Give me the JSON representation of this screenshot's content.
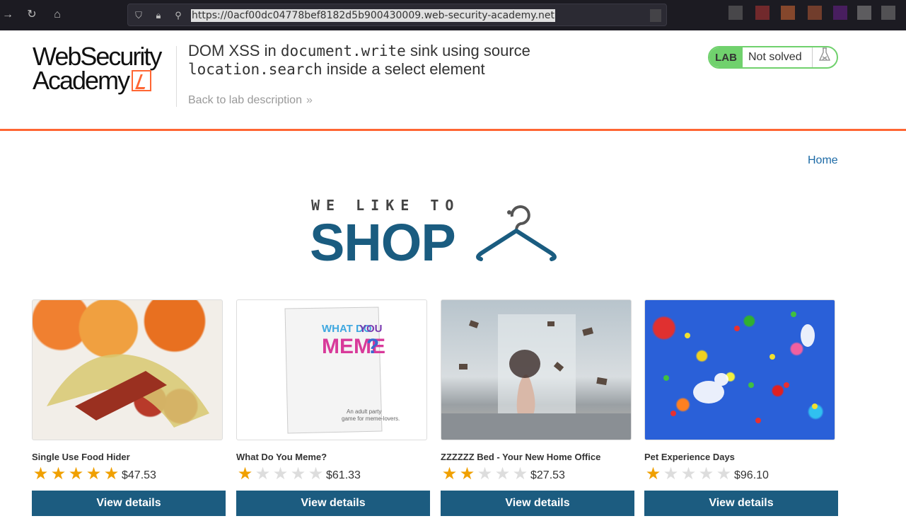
{
  "browser": {
    "url": "https://0acf00dc04778bef8182d5b900430009.web-security-academy.net",
    "back_icon": "arrow-right-icon",
    "reload_icon": "reload-icon",
    "home_icon": "home-icon"
  },
  "lab": {
    "logo_line1": "WebSecurity",
    "logo_line2": "Academy",
    "title_part1": "DOM XSS in ",
    "title_code1": "document.write",
    "title_part2": " sink using source ",
    "title_code2": "location.search",
    "title_part3": " inside a select element",
    "back_link": "Back to lab description",
    "status_badge": "LAB",
    "status_text": "Not solved"
  },
  "shop": {
    "home_link": "Home",
    "banner_small": "WE LIKE TO",
    "banner_big": "SHOP"
  },
  "products": [
    {
      "name": "Single Use Food Hider",
      "rating": 5,
      "price": "$47.53",
      "button": "View details"
    },
    {
      "name": "What Do You Meme?",
      "rating": 1,
      "price": "$61.33",
      "button": "View details"
    },
    {
      "name": "ZZZZZZ Bed - Your New Home Office",
      "rating": 2,
      "price": "$27.53",
      "button": "View details"
    },
    {
      "name": "Pet Experience Days",
      "rating": 1,
      "price": "$96.10",
      "button": "View details"
    }
  ],
  "colors": {
    "accent_orange": "#ff6633",
    "status_green": "#70d16d",
    "brand_blue": "#1c5c80",
    "link_blue": "#1c6aa6",
    "star_gold": "#f0a000"
  }
}
